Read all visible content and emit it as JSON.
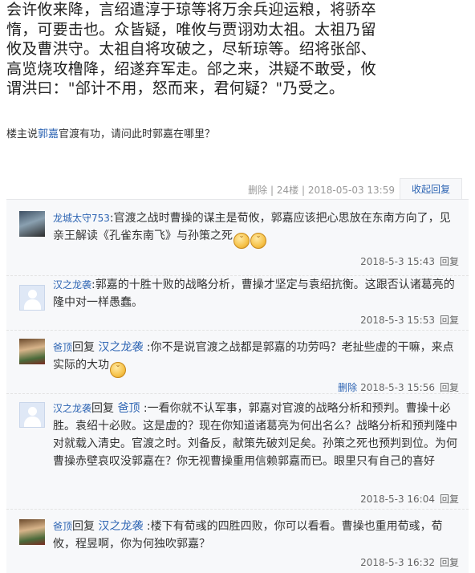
{
  "quote_text": "会许攸来降，言绍遣淳于琼等将万余兵迎运粮，将骄卒\n惰，可要击也。众皆疑，唯攸与贾诩劝太祖。太祖乃留\n攸及曹洪守。太祖自将攻破之，尽斩琼等。绍将张郃、\n高览烧攻橹降，绍遂弃军走。郃之来，洪疑不敢受，攸\n谓洪曰：\"郃计不用，怒而来，君何疑？\"乃受之。",
  "question": {
    "prefix": "楼主说",
    "link": "郭嘉",
    "suffix": "官渡有功，请问此时郭嘉在哪里？"
  },
  "post_meta": {
    "delete": "删除",
    "sep": "|",
    "floor": "24楼",
    "date": "2018-05-03 13:59",
    "fold": "收起回复"
  },
  "replies": [
    {
      "user": "龙城太守753",
      "reply_to": "",
      "colon": ":",
      "content": "官渡之战时曹操的谋主是荀攸，郭嘉应该把心思放在东南方向了，见亲王解读《孔雀东南飞》与孙策之死",
      "emoji_count": 2,
      "time": "2018-5-3 15:43",
      "reply_label": "回复",
      "delete": ""
    },
    {
      "user": "汉之龙袭",
      "reply_to": "",
      "colon": ":",
      "content": "郭嘉的十胜十败的战略分析，曹操才坚定与袁绍抗衡。这跟否认诸葛亮的隆中对一样愚蠢。",
      "emoji_count": 0,
      "time": "2018-5-3 15:53",
      "reply_label": "回复",
      "delete": ""
    },
    {
      "user": "爸顶",
      "reply_word": "回复",
      "reply_to": "汉之龙袭",
      "colon": ":",
      "content": "你不是说官渡之战都是郭嘉的功劳吗？老扯些虚的干嘛，来点实际的大功",
      "emoji_count": 1,
      "time": "2018-5-3 15:56",
      "reply_label": "回复",
      "delete": "删除"
    },
    {
      "user": "汉之龙袭",
      "reply_word": "回复",
      "reply_to": "爸顶",
      "colon": ":",
      "content": "一看你就不认军事，郭嘉对官渡的战略分析和预判。曹操十必胜。袁绍十必败。这是虚的？现在你知道诸葛亮为何出名么？战略分析和预判隆中对就载入清史。官渡之时。刘备反，献策先破刘足矣。孙策之死也预判到位。为何曹操赤壁哀叹没郭嘉在？你无视曹操重用信赖郭嘉而已。眼里只有自己的喜好",
      "emoji_count": 0,
      "time": "2018-5-3 16:04",
      "reply_label": "回复",
      "delete": ""
    },
    {
      "user": "爸顶",
      "reply_word": "回复",
      "reply_to": "汉之龙袭",
      "colon": ":",
      "content": "楼下有荀彧的四胜四败，你可以看看。曹操也重用荀彧，荀攸，程昱啊，你为何独吹郭嘉？",
      "emoji_count": 0,
      "time": "2018-5-3 16:32",
      "reply_label": "回复",
      "delete": ""
    }
  ]
}
